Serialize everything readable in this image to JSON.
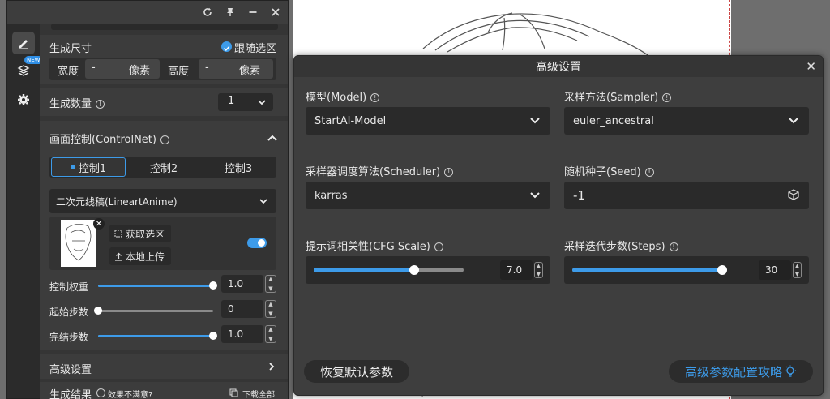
{
  "panel": {
    "size_title": "生成尺寸",
    "follow_selection": "跟随选区",
    "width_label": "宽度",
    "width_value": "-",
    "width_unit": "像素",
    "height_label": "高度",
    "height_value": "-",
    "height_unit": "像素",
    "count_label": "生成数量",
    "count_value": "1",
    "controlnet_title": "画面控制(ControlNet)",
    "tabs": [
      "控制1",
      "控制2",
      "控制3"
    ],
    "model_select": "二次元线稿(LineartAnime)",
    "get_selection": "获取选区",
    "local_upload": "本地上传",
    "weight_label": "控制权重",
    "weight_value": "1.0",
    "weight_level": 1.0,
    "start_label": "起始步数",
    "start_value": "0",
    "start_level": 0.0,
    "end_label": "完结步数",
    "end_value": "1.0",
    "end_level": 1.0,
    "advanced_label": "高级设置",
    "result_label": "生成结果",
    "unsatisfied": "效果不满意?",
    "download_all": "下载全部",
    "new_badge": "NEW"
  },
  "dialog": {
    "title": "高级设置",
    "model_label": "模型(Model)",
    "model_value": "StartAI-Model",
    "sampler_label": "采样方法(Sampler)",
    "sampler_value": "euler_ancestral",
    "scheduler_label": "采样器调度算法(Scheduler)",
    "scheduler_value": "karras",
    "seed_label": "随机种子(Seed)",
    "seed_value": "-1",
    "cfg_label": "提示词相关性(CFG Scale)",
    "cfg_value": "7.0",
    "cfg_level": 0.67,
    "steps_label": "采样迭代步数(Steps)",
    "steps_value": "30",
    "steps_level": 1.0,
    "reset_button": "恢复默认参数",
    "guide_link": "高级参数配置攻略"
  },
  "colors": {
    "accent": "#3d9be9",
    "panel_bg": "#3a3a3a",
    "input_bg": "#2a2a2a"
  }
}
